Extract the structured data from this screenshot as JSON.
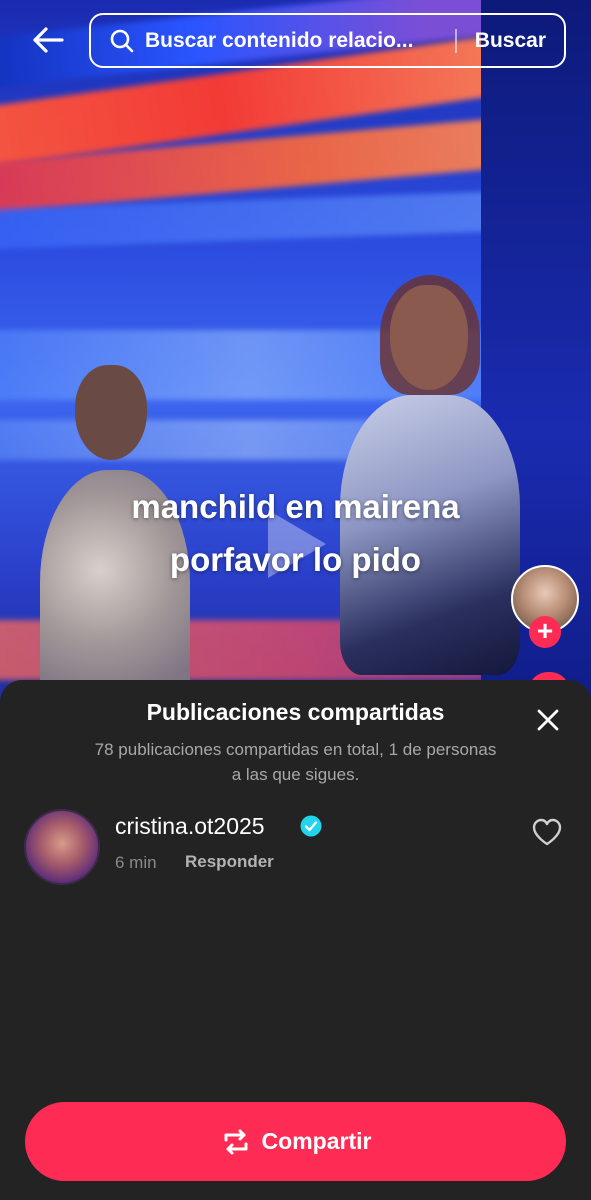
{
  "search": {
    "placeholder": "Buscar contenido relacio...",
    "submit_label": "Buscar"
  },
  "video": {
    "caption_line1": "manchild en mairena",
    "caption_line2": "porfavor lo pido"
  },
  "sheet": {
    "title": "Publicaciones compartidas",
    "subtitle": "78 publicaciones compartidas en total, 1 de personas a las que sigues.",
    "items": [
      {
        "username": "cristina.ot2025",
        "verified": true,
        "time": "6 min",
        "reply_label": "Responder"
      }
    ],
    "share_label": "Compartir"
  },
  "colors": {
    "accent": "#fe2c55",
    "sheet_bg": "#232323",
    "verified": "#20d5ec"
  },
  "icons": [
    "back-arrow-icon",
    "search-icon",
    "play-icon",
    "plus-icon",
    "close-icon",
    "verified-icon",
    "heart-icon",
    "repost-icon"
  ]
}
